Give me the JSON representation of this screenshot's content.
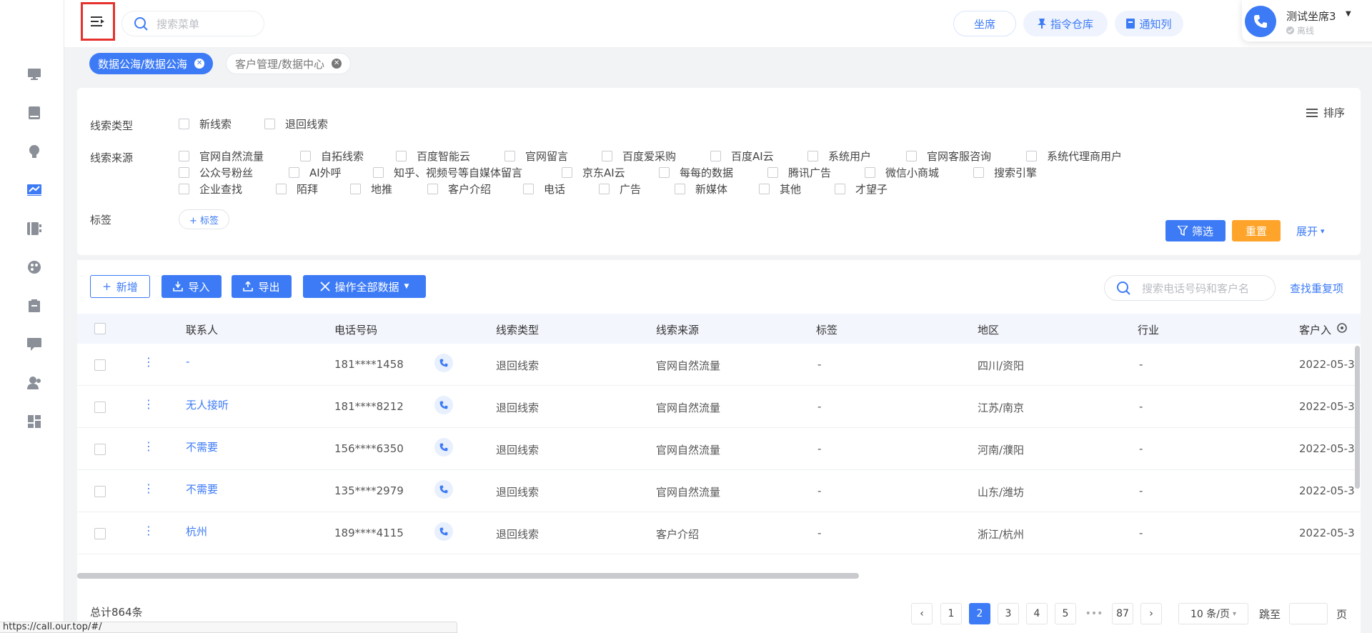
{
  "header": {
    "search_placeholder": "搜索菜单",
    "pills": [
      "坐席",
      "指令仓库",
      "通知列"
    ],
    "agent": {
      "name": "测试坐席3",
      "status": "离线"
    }
  },
  "tabs": [
    {
      "label": "数据公海/数据公海",
      "active": true
    },
    {
      "label": "客户管理/数据中心",
      "active": false
    }
  ],
  "filters": {
    "type_label": "线索类型",
    "types": [
      "新线索",
      "退回线索"
    ],
    "source_label": "线索来源",
    "sources_row1": [
      "官网自然流量",
      "自拓线索",
      "百度智能云",
      "官网留言",
      "百度爱采购",
      "百度AI云",
      "系统用户",
      "官网客服咨询",
      "系统代理商用户"
    ],
    "sources_row2": [
      "公众号粉丝",
      "AI外呼",
      "知乎、视频号等自媒体留言",
      "京东AI云",
      "每每的数据",
      "腾讯广告",
      "微信小商城",
      "搜索引擎"
    ],
    "sources_row3": [
      "企业查找",
      "陌拜",
      "地推",
      "客户介绍",
      "电话",
      "广告",
      "新媒体",
      "其他",
      "才望子"
    ],
    "tag_label": "标签",
    "tag_button": "+ 标签",
    "sort": "排序",
    "filter_btn": "筛选",
    "reset_btn": "重置",
    "expand": "展开"
  },
  "toolbar": {
    "add": "新增",
    "import": "导入",
    "export": "导出",
    "operate_all": "操作全部数据",
    "search_placeholder": "搜索电话号码和客户名",
    "find_dup": "查找重复项"
  },
  "table": {
    "columns": [
      "联系人",
      "电话号码",
      "线索类型",
      "线索来源",
      "标签",
      "地区",
      "行业",
      "客户入"
    ],
    "rows": [
      {
        "contact": "-",
        "phone": "181****1458",
        "type": "退回线索",
        "source": "官网自然流量",
        "tag": "-",
        "region": "四川/资阳",
        "industry": "-",
        "date": "2022-05-3"
      },
      {
        "contact": "无人接听",
        "phone": "181****8212",
        "type": "退回线索",
        "source": "官网自然流量",
        "tag": "-",
        "region": "江苏/南京",
        "industry": "-",
        "date": "2022-05-3"
      },
      {
        "contact": "不需要",
        "phone": "156****6350",
        "type": "退回线索",
        "source": "官网自然流量",
        "tag": "-",
        "region": "河南/濮阳",
        "industry": "-",
        "date": "2022-05-3"
      },
      {
        "contact": "不需要",
        "phone": "135****2979",
        "type": "退回线索",
        "source": "官网自然流量",
        "tag": "-",
        "region": "山东/潍坊",
        "industry": "-",
        "date": "2022-05-3"
      },
      {
        "contact": "杭州",
        "phone": "189****4115",
        "type": "退回线索",
        "source": "客户介绍",
        "tag": "-",
        "region": "浙江/杭州",
        "industry": "-",
        "date": "2022-05-3"
      }
    ]
  },
  "pagination": {
    "total": "总计864条",
    "pages": [
      "1",
      "2",
      "3",
      "4",
      "5",
      "87"
    ],
    "ellipsis": "•••",
    "current": "2",
    "page_size": "10 条/页",
    "jump_label": "跳至",
    "page_label": "页"
  },
  "status_bar": {
    "url": "https://call.our.top/#/"
  },
  "colors": {
    "primary": "#3d7bf6",
    "orange": "#ffa42b",
    "highlight": "#e5322d"
  }
}
